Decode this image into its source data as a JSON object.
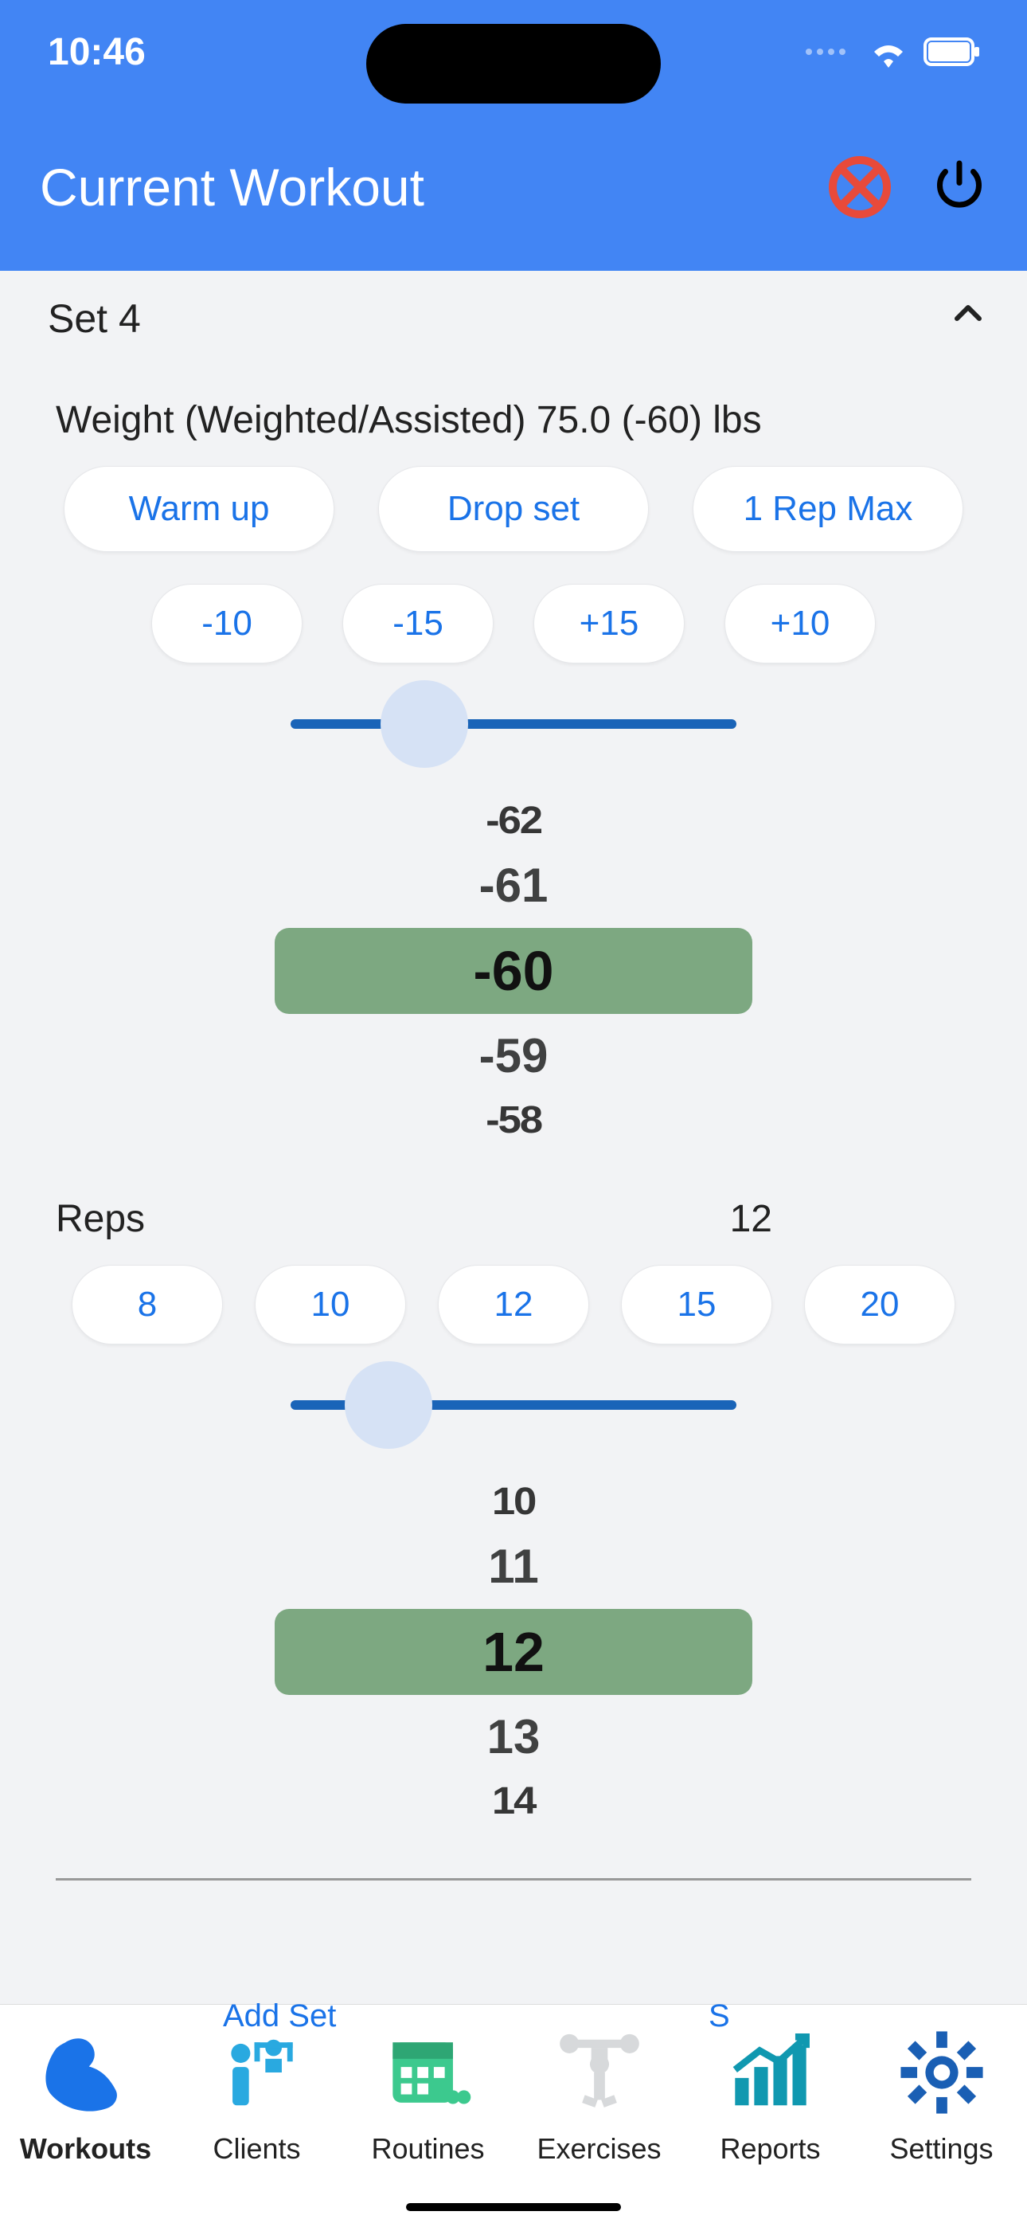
{
  "status": {
    "time": "10:46"
  },
  "header": {
    "title": "Current Workout"
  },
  "set": {
    "label": "Set 4"
  },
  "weight": {
    "label": "Weight (Weighted/Assisted) 75.0 (-60) lbs",
    "type_pills": [
      "Warm up",
      "Drop set",
      "1 Rep Max"
    ],
    "adjust_pills": [
      "-10",
      "-15",
      "+15",
      "+10"
    ],
    "slider_pct": 30,
    "picker": {
      "opts": [
        "-62",
        "-61",
        "-60",
        "-59",
        "-58"
      ],
      "selected": "-60"
    }
  },
  "reps": {
    "label": "Reps",
    "value": "12",
    "quick": [
      "8",
      "10",
      "12",
      "15",
      "20"
    ],
    "slider_pct": 22,
    "picker": {
      "opts": [
        "10",
        "11",
        "12",
        "13",
        "14"
      ],
      "selected": "12"
    }
  },
  "partial": {
    "left": "Add Set",
    "right": "S"
  },
  "nav": {
    "items": [
      {
        "label": "Workouts",
        "active": true
      },
      {
        "label": "Clients",
        "active": false
      },
      {
        "label": "Routines",
        "active": false
      },
      {
        "label": "Exercises",
        "active": false
      },
      {
        "label": "Reports",
        "active": false
      },
      {
        "label": "Settings",
        "active": false
      }
    ]
  }
}
